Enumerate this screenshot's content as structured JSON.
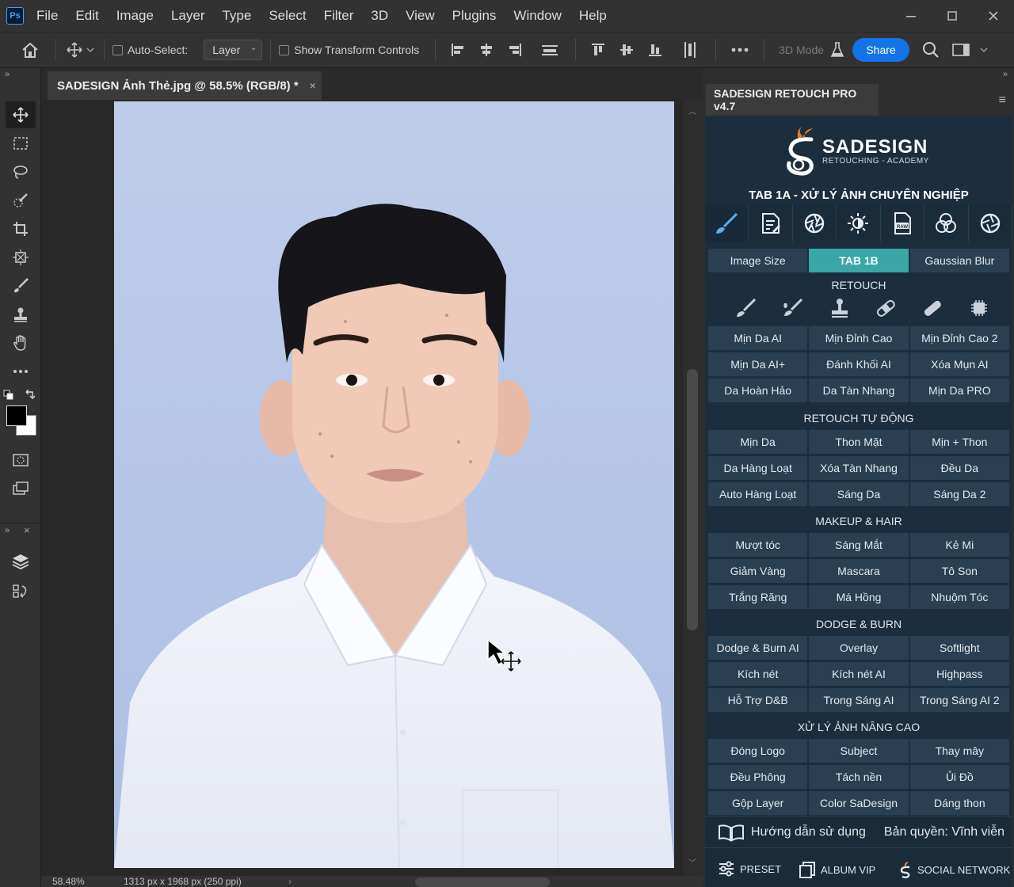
{
  "menubar": {
    "app_icon": "Ps",
    "items": [
      "File",
      "Edit",
      "Image",
      "Layer",
      "Type",
      "Select",
      "Filter",
      "3D",
      "View",
      "Plugins",
      "Window",
      "Help"
    ]
  },
  "options": {
    "auto_select_label": "Auto-Select:",
    "layer_value": "Layer",
    "show_transform_label": "Show Transform Controls",
    "mode_3d_label": "3D Mode",
    "share_label": "Share"
  },
  "document": {
    "tab_title": "SADESIGN Ảnh Thẻ.jpg @ 58.5% (RGB/8) *",
    "close_glyph": "×"
  },
  "status": {
    "zoom": "58.48%",
    "dimensions": "1313 px x 1968 px (250 ppi)"
  },
  "panel": {
    "tab_title": "SADESIGN RETOUCH PRO v4.7",
    "brand_name": "SADESIGN",
    "brand_sub": "RETOUCHING - ACADEMY",
    "title": "TAB 1A - XỬ LÝ ẢNH CHUYÊN NGHIỆP",
    "top_buttons": [
      "Image Size",
      "TAB 1B",
      "Gaussian Blur"
    ],
    "sections": [
      {
        "title": "RETOUCH",
        "buttons": [
          "Mịn Da AI",
          "Mịn Đỉnh Cao",
          "Mịn Đỉnh Cao 2",
          "Mịn Da AI+",
          "Đánh Khối AI",
          "Xóa Mụn AI",
          "Da Hoàn Hảo",
          "Da Tàn Nhang",
          "Mịn Da PRO"
        ]
      },
      {
        "title": "RETOUCH TỰ ĐỘNG",
        "buttons": [
          "Mịn Da",
          "Thon Mặt",
          "Mịn + Thon",
          "Da Hàng Loạt",
          "Xóa Tàn Nhang",
          "Đều Da",
          "Auto Hàng Loạt",
          "Sáng Da",
          "Sáng Da 2"
        ]
      },
      {
        "title": "MAKEUP & HAIR",
        "buttons": [
          "Mượt tóc",
          "Sáng Mắt",
          "Kẻ Mi",
          "Giảm Vàng",
          "Mascara",
          "Tô Son",
          "Trắng Răng",
          "Má Hồng",
          "Nhuộm Tóc"
        ]
      },
      {
        "title": "DODGE & BURN",
        "buttons": [
          "Dodge & Burn AI",
          "Overlay",
          "Softlight",
          "Kích nét",
          "Kích nét AI",
          "Highpass",
          "Hỗ Trợ D&B",
          "Trong Sáng AI",
          "Trong Sáng AI 2"
        ]
      },
      {
        "title": "XỬ LÝ ẢNH NÂNG CAO",
        "buttons": [
          "Đóng Logo",
          "Subject",
          "Thay mây",
          "Đều Phông",
          "Tách nền",
          "Ủi Đồ",
          "Gộp Layer",
          "Color SaDesign",
          "Dáng thon"
        ]
      }
    ],
    "guide_label": "Hướng dẫn sử dụng",
    "license_label": "Bản quyền: Vĩnh viễn",
    "footer": [
      "PRESET",
      "ALBUM VIP",
      "SOCIAL NETWORK"
    ]
  },
  "colors": {
    "ps_blue": "#31a8ff",
    "share_blue": "#1473e6",
    "panel_bg": "#1c2e3e",
    "button_bg": "#2a3f52",
    "active_tab": "#38a7a5",
    "accent_orange": "#f07a2a"
  }
}
